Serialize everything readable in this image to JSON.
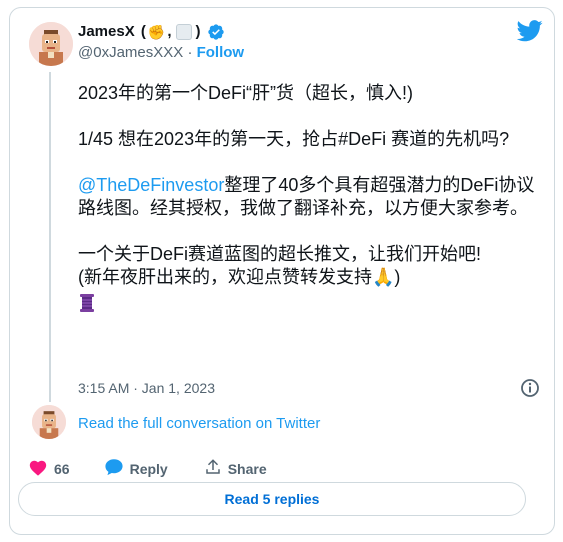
{
  "author": {
    "name": "JamesX",
    "name_emoji_suffix": "(✊, ⬜)",
    "handle": "@0xJamesXXX",
    "separator": "·",
    "follow_label": "Follow"
  },
  "tweet": {
    "line1": "2023年的第一个DeFi“肝”货（超长，慎入!)",
    "line2": "1/45 想在2023年的第一天，抢占#DeFi 赛道的先机吗?",
    "mention": "@TheDeFinvestor",
    "line3_rest": "整理了40多个具有超强潜力的DeFi协议路线图。经其授权，我做了翻译补充，以方便大家参考。",
    "line4a": "一个关于DeFi赛道蓝图的超长推文，让我们开始吧!",
    "line4b": "(新年夜肝出来的，欢迎点赞转发支持🙏)",
    "timestamp": "3:15 AM · Jan 1, 2023"
  },
  "thread": {
    "read_full_label": "Read the full conversation on Twitter"
  },
  "actions": {
    "like_count": "66",
    "reply_label": "Reply",
    "share_label": "Share"
  },
  "footer": {
    "read_replies_label": "Read 5 replies"
  },
  "colors": {
    "link": "#1d9bf0",
    "like": "#f91880",
    "muted": "#536471"
  },
  "icons": [
    "verified-badge-icon",
    "twitter-bird-icon",
    "info-icon",
    "heart-icon",
    "reply-bubble-icon",
    "share-icon",
    "thread-spool-icon",
    "pray-hands-emoji"
  ]
}
